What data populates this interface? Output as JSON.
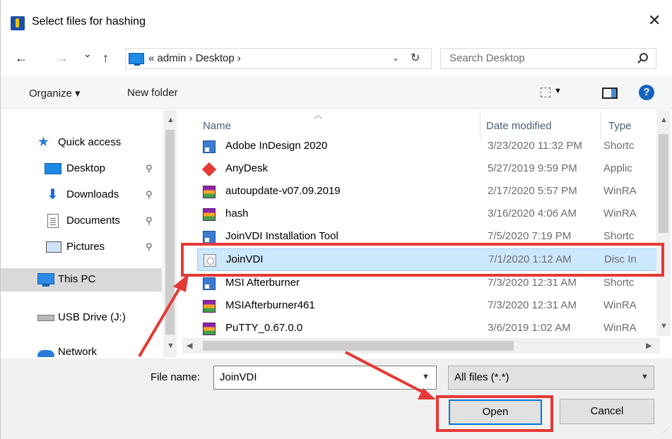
{
  "window": {
    "title": "Select files for hashing",
    "close_glyph": "✕"
  },
  "nav": {
    "back_glyph": "←",
    "forward_glyph": "→",
    "recent_glyph": "⌄",
    "up_glyph": "↑",
    "address": "« admin  ›  Desktop  ›",
    "address_drop": "⌄",
    "refresh_glyph": "↻",
    "search_placeholder": "Search Desktop"
  },
  "toolbar": {
    "organize": "Organize ▾",
    "new_folder": "New folder",
    "help": "?"
  },
  "sidebar": {
    "items": [
      {
        "label": "Quick access",
        "icon": "star-icon",
        "pinned": false
      },
      {
        "label": "Desktop",
        "icon": "desktop-icon",
        "pinned": true
      },
      {
        "label": "Downloads",
        "icon": "download-icon",
        "pinned": true
      },
      {
        "label": "Documents",
        "icon": "documents-icon",
        "pinned": true
      },
      {
        "label": "Pictures",
        "icon": "pictures-icon",
        "pinned": true
      },
      {
        "label": "This PC",
        "icon": "pc-icon",
        "pinned": false,
        "selected": true
      },
      {
        "label": "USB Drive (J:)",
        "icon": "usb-drive-icon",
        "pinned": false
      },
      {
        "label": "Network",
        "icon": "network-icon",
        "pinned": false
      }
    ],
    "pin_glyph": "📌"
  },
  "file_list": {
    "columns": [
      "Name",
      "Date modified",
      "Type"
    ],
    "rows": [
      {
        "name": "Adobe InDesign 2020",
        "date": "3/23/2020 11:32 PM",
        "type": "Shortc",
        "icon": "shortcut-icon"
      },
      {
        "name": "AnyDesk",
        "date": "5/27/2019 9:59 PM",
        "type": "Applic",
        "icon": "anydesk-icon"
      },
      {
        "name": "autoupdate-v07.09.2019",
        "date": "2/17/2020 5:57 PM",
        "type": "WinRA",
        "icon": "winrar-icon"
      },
      {
        "name": "hash",
        "date": "3/16/2020 4:06 AM",
        "type": "WinRA",
        "icon": "winrar-icon"
      },
      {
        "name": "JoinVDI Installation Tool",
        "date": "7/5/2020 7:19 PM",
        "type": "Shortc",
        "icon": "shortcut-icon"
      },
      {
        "name": "JoinVDI",
        "date": "7/1/2020 1:12 AM",
        "type": "Disc In",
        "icon": "disc-image-icon",
        "selected": true
      },
      {
        "name": "MSI Afterburner",
        "date": "7/3/2020 12:31 AM",
        "type": "Shortc",
        "icon": "shortcut-icon"
      },
      {
        "name": "MSIAfterburner461",
        "date": "7/3/2020 12:31 AM",
        "type": "WinRA",
        "icon": "winrar-icon"
      },
      {
        "name": "PuTTY_0.67.0.0",
        "date": "3/6/2019 1:02 AM",
        "type": "WinRA",
        "icon": "winrar-icon"
      }
    ]
  },
  "footer": {
    "file_name_label": "File name:",
    "file_name_value": "JoinVDI",
    "file_type_value": "All files (*.*)",
    "open_label": "Open",
    "cancel_label": "Cancel"
  },
  "colors": {
    "highlight": "#e53935",
    "selection": "#cce8ff",
    "accent": "#0078d7"
  }
}
